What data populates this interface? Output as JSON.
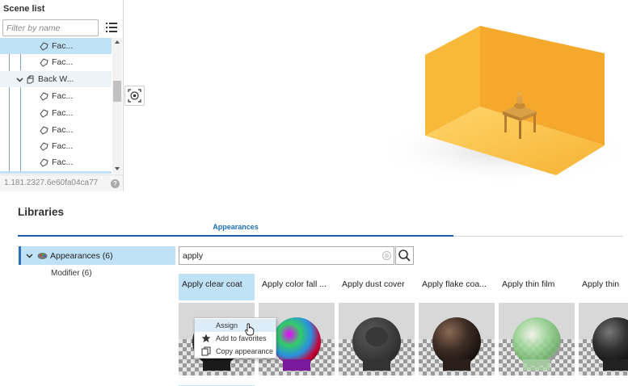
{
  "scene_list": {
    "title": "Scene list",
    "filter_placeholder": "Filter by name",
    "items": [
      {
        "label": "Fac...",
        "type": "face",
        "selected": true
      },
      {
        "label": "Fac...",
        "type": "face"
      },
      {
        "label": "Back W...",
        "type": "body",
        "expanded": true
      },
      {
        "label": "Fac...",
        "type": "face"
      },
      {
        "label": "Fac...",
        "type": "face"
      },
      {
        "label": "Fac...",
        "type": "face"
      },
      {
        "label": "Fac...",
        "type": "face"
      },
      {
        "label": "Fac...",
        "type": "face"
      }
    ],
    "version": "1.181.2327.6e60fa04ca77",
    "help_label": "?"
  },
  "libraries": {
    "title": "Libraries",
    "tab": "Appearances",
    "tree": {
      "root_label": "Appearances (6)",
      "child_label": "Modifier (6)"
    },
    "search": {
      "value": "apply",
      "clear_label": "⊗"
    },
    "cards": [
      {
        "label": "Apply clear coat",
        "material": "black-gloss",
        "active": true
      },
      {
        "label": "Apply color fall ...",
        "material": "iridescent"
      },
      {
        "label": "Apply dust cover",
        "material": "dark-matte"
      },
      {
        "label": "Apply flake coa...",
        "material": "dark-flake"
      },
      {
        "label": "Apply thin film",
        "material": "thin-film"
      },
      {
        "label": "Apply thin",
        "material": "dark-gloss"
      }
    ]
  },
  "context_menu": {
    "items": [
      {
        "label": "Assign",
        "icon": "none",
        "hovered": true
      },
      {
        "label": "Add to favorites",
        "icon": "star-icon"
      },
      {
        "label": "Copy appearance",
        "icon": "copy-icon"
      }
    ]
  },
  "colors": {
    "selection": "#bfe2f7",
    "accent": "#1d5ea8",
    "room_orange": "#f7b733"
  }
}
